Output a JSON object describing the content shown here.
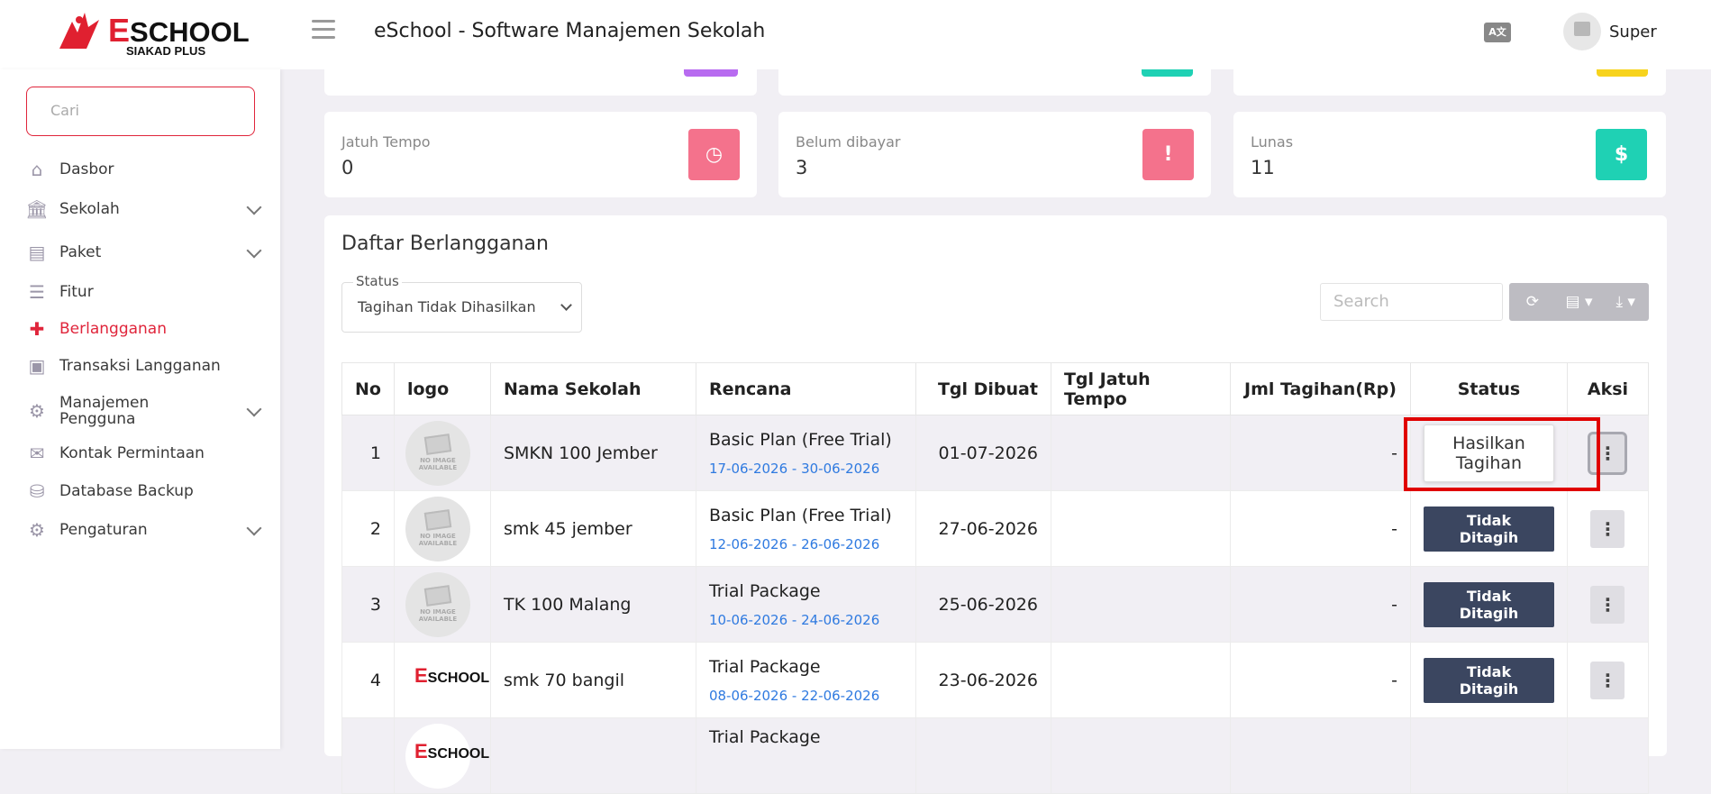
{
  "header": {
    "logo_main": "SCHOOL",
    "logo_e": "E",
    "logo_sub": "SIAKAD PLUS",
    "title": "eSchool - Software Manajemen Sekolah",
    "lang_icon": "A文",
    "user_name": "Super"
  },
  "sidebar": {
    "search_placeholder": "Cari",
    "items": [
      {
        "label": "Dasbor",
        "icon": "home-icon",
        "glyph": "⌂"
      },
      {
        "label": "Sekolah",
        "icon": "bank-icon",
        "glyph": "🏛"
      },
      {
        "label": "Paket",
        "icon": "archive-icon",
        "glyph": "▤"
      },
      {
        "label": "Fitur",
        "icon": "list-icon",
        "glyph": "☰"
      },
      {
        "label": "Berlangganan",
        "icon": "puzzle-icon",
        "glyph": "✚"
      },
      {
        "label": "Transaksi Langganan",
        "icon": "money-icon",
        "glyph": "▣"
      },
      {
        "label": "Manajemen",
        "label2": "Pengguna",
        "icon": "users-cog-icon",
        "glyph": "⚙"
      },
      {
        "label": "Kontak Permintaan",
        "icon": "envelope-icon",
        "glyph": "✉"
      },
      {
        "label": "Database Backup",
        "icon": "database-icon",
        "glyph": "⛁"
      },
      {
        "label": "Pengaturan",
        "icon": "gear-icon",
        "glyph": "⚙"
      }
    ]
  },
  "stats": [
    {
      "label": "Jatuh Tempo",
      "value": "0",
      "icon": "clock-icon",
      "glyph": "◷",
      "color": "#f4728c"
    },
    {
      "label": "Belum dibayar",
      "value": "3",
      "icon": "alert-icon",
      "glyph": "!",
      "color": "#f4728c"
    },
    {
      "label": "Lunas",
      "value": "11",
      "icon": "money-icon",
      "glyph": "$",
      "color": "#1fd1b4"
    }
  ],
  "top_card_colors": [
    "#b86bf0",
    "#1fd1b4",
    "#f7d31d"
  ],
  "panel": {
    "title": "Daftar Berlangganan",
    "status_label": "Status",
    "status_value": "Tagihan Tidak Dihasilkan",
    "search_placeholder": "Search"
  },
  "table": {
    "headers": [
      "No",
      "logo",
      "Nama Sekolah",
      "Rencana",
      "Tgl Dibuat",
      "Tgl Jatuh Tempo",
      "Jml Tagihan(Rp)",
      "Status",
      "Aksi"
    ],
    "rows": [
      {
        "no": "1",
        "logo": "noimg",
        "nama": "SMKN 100 Jember",
        "plan": "Basic Plan (Free Trial)",
        "period": "17-06-2026 - 30-06-2026",
        "tgl": "01-07-2026",
        "jt": "",
        "jml": "-",
        "status": "Hasilkan Tagihan",
        "status_type": "button"
      },
      {
        "no": "2",
        "logo": "noimg",
        "nama": "smk 45 jember",
        "plan": "Basic Plan (Free Trial)",
        "period": "12-06-2026 - 26-06-2026",
        "tgl": "27-06-2026",
        "jt": "",
        "jml": "-",
        "status": "Tidak Ditagih",
        "status_type": "badge"
      },
      {
        "no": "3",
        "logo": "noimg",
        "nama": "TK 100 Malang",
        "plan": "Trial Package",
        "period": "10-06-2026 - 24-06-2026",
        "tgl": "25-06-2026",
        "jt": "",
        "jml": "-",
        "status": "Tidak Ditagih",
        "status_type": "badge"
      },
      {
        "no": "4",
        "logo": "eschool",
        "nama": "smk 70 bangil",
        "plan": "Trial Package",
        "period": "08-06-2026 - 22-06-2026",
        "tgl": "23-06-2026",
        "jt": "",
        "jml": "-",
        "status": "Tidak Ditagih",
        "status_type": "badge"
      },
      {
        "no": "",
        "logo": "eschool",
        "nama": "",
        "plan": "Trial Package",
        "period": "",
        "tgl": "",
        "jt": "",
        "jml": "",
        "status": "",
        "status_type": "badge"
      }
    ],
    "no_image_text": "NO IMAGE AVAILABLE",
    "kebab_glyph": "⋮"
  }
}
